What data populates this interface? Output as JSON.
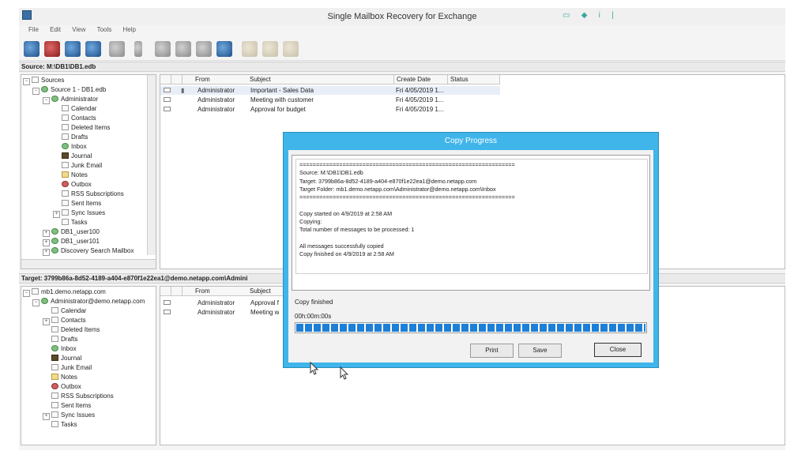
{
  "window": {
    "title": "Single Mailbox Recovery for Exchange"
  },
  "menu": [
    "File",
    "Edit",
    "View",
    "Tools",
    "Help"
  ],
  "source_bar": "Source: M:\\DB1\\DB1.edb",
  "source_tree": [
    {
      "label": "Sources",
      "icon": "sources-icon"
    },
    {
      "label": "Source 1 - DB1.edb",
      "icon": "database-icon"
    },
    {
      "label": "Administrator",
      "icon": "mailbox-icon"
    },
    {
      "label": "Calendar",
      "icon": "calendar-icon"
    },
    {
      "label": "Contacts",
      "icon": "contacts-icon"
    },
    {
      "label": "Deleted Items",
      "icon": "trash-icon"
    },
    {
      "label": "Drafts",
      "icon": "drafts-icon"
    },
    {
      "label": "Inbox",
      "icon": "inbox-icon"
    },
    {
      "label": "Journal",
      "icon": "journal-icon"
    },
    {
      "label": "Junk Email",
      "icon": "junk-icon"
    },
    {
      "label": "Notes",
      "icon": "notes-icon"
    },
    {
      "label": "Outbox",
      "icon": "outbox-icon"
    },
    {
      "label": "RSS Subscriptions",
      "icon": "rss-icon"
    },
    {
      "label": "Sent Items",
      "icon": "sent-icon"
    },
    {
      "label": "Sync Issues",
      "icon": "sync-icon"
    },
    {
      "label": "Tasks",
      "icon": "tasks-icon"
    },
    {
      "label": "DB1_user100",
      "icon": "mailbox-icon"
    },
    {
      "label": "DB1_user101",
      "icon": "mailbox-icon"
    },
    {
      "label": "Discovery Search Mailbox",
      "icon": "mailbox-icon"
    }
  ],
  "source_list": {
    "headers": [
      "From",
      "Subject",
      "Create Date",
      "Status"
    ],
    "rows": [
      {
        "from": "Administrator",
        "subject": "Important - Sales Data",
        "date": "Fri 4/05/2019 1..."
      },
      {
        "from": "Administrator",
        "subject": "Meeting with customer",
        "date": "Fri 4/05/2019 1..."
      },
      {
        "from": "Administrator",
        "subject": "Approval for budget",
        "date": "Fri 4/05/2019 1..."
      }
    ]
  },
  "target_bar": "Target: 3799b86a-8d52-4189-a404-e870f1e22ea1@demo.netapp.com\\Admini",
  "target_tree": [
    {
      "label": "mb1.demo.netapp.com"
    },
    {
      "label": "Administrator@demo.netapp.com"
    },
    {
      "label": "Calendar"
    },
    {
      "label": "Contacts"
    },
    {
      "label": "Deleted Items"
    },
    {
      "label": "Drafts"
    },
    {
      "label": "Inbox"
    },
    {
      "label": "Journal"
    },
    {
      "label": "Junk Email"
    },
    {
      "label": "Notes"
    },
    {
      "label": "Outbox"
    },
    {
      "label": "RSS Subscriptions"
    },
    {
      "label": "Sent Items"
    },
    {
      "label": "Sync Issues"
    },
    {
      "label": "Tasks"
    }
  ],
  "target_list": {
    "headers": [
      "From",
      "Subject"
    ],
    "rows": [
      {
        "from": "Administrator",
        "subject": "Approval f"
      },
      {
        "from": "Administrator",
        "subject": "Meeting w"
      }
    ]
  },
  "dialog": {
    "title": "Copy Progress",
    "log": [
      "=================================================================",
      "Source: M:\\DB1\\DB1.edb",
      "Target: 3799b86a-8d52-4189-a404-e870f1e22ea1@demo.netapp.com",
      "Target Folder: mb1.demo.netapp.com\\Administrator@demo.netapp.com\\Inbox",
      "=================================================================",
      "",
      "Copy started on 4/9/2019 at 2:58 AM",
      "Copying:",
      "Total number of messages to be processed: 1",
      "",
      "All messages successfully copied",
      "Copy finished on 4/9/2019 at 2:58 AM"
    ],
    "status": "Copy finished",
    "elapsed": "00h:00m:00s",
    "progress": 1.0,
    "buttons": {
      "print": "Print",
      "save": "Save",
      "close": "Close"
    }
  }
}
